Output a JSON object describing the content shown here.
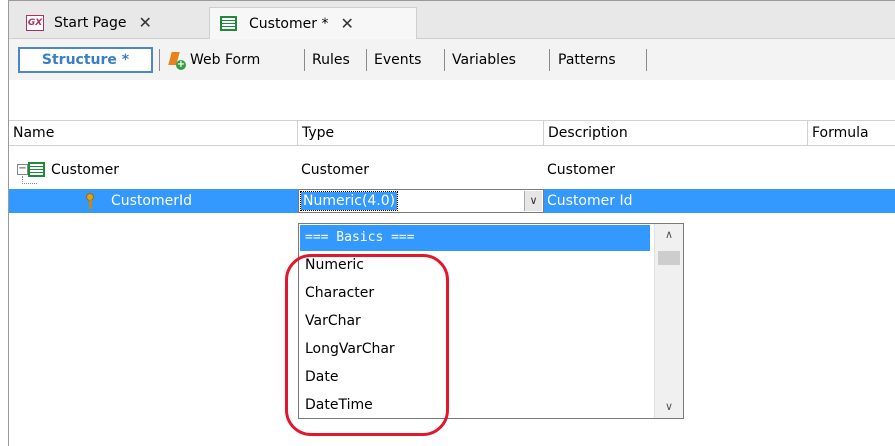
{
  "tabs": [
    {
      "icon": "gx-logo-icon",
      "label": "Start Page"
    },
    {
      "icon": "transaction-icon",
      "label": "Customer *"
    }
  ],
  "toolbar": {
    "tabs": [
      "Structure *",
      "Web Form",
      "Rules",
      "Events",
      "Variables",
      "Patterns"
    ]
  },
  "grid": {
    "columns": [
      "Name",
      "Type",
      "Description",
      "Formula"
    ],
    "rows": [
      {
        "name": "Customer",
        "type": "Customer",
        "description": "Customer"
      },
      {
        "name": "CustomerId",
        "type": "Numeric(4.0)",
        "description": "Customer Id"
      }
    ]
  },
  "dropdown": {
    "items": [
      "=== Basics ===",
      "Numeric",
      "Character",
      "VarChar",
      "LongVarChar",
      "Date",
      "DateTime"
    ],
    "selected": "=== Basics ==="
  },
  "colors": {
    "selection": "#3399ff",
    "highlight": "#e2162c",
    "active_tab": "#3a7fc2"
  }
}
